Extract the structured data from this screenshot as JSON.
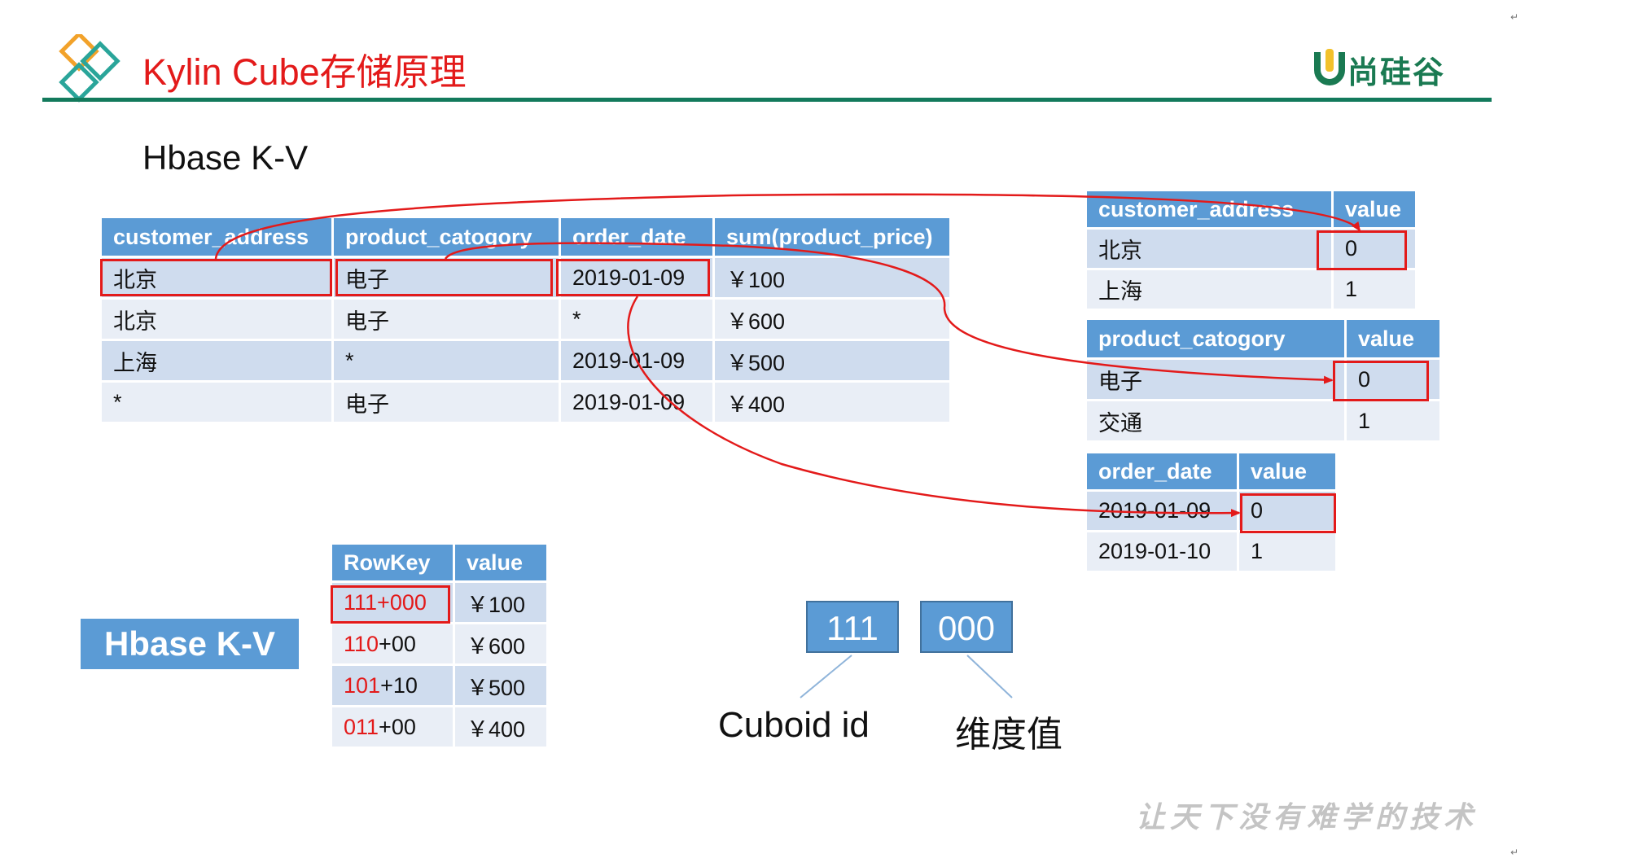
{
  "header": {
    "title": "Kylin Cube存储原理",
    "logo_text": "尚硅谷",
    "corner_mark": "↵"
  },
  "subtitle": "Hbase K-V",
  "source_table": {
    "columns": [
      "customer_address",
      "product_catogory",
      "order_date",
      "sum(product_price)"
    ],
    "rows": [
      [
        "北京",
        "电子",
        "2019-01-09",
        "￥100"
      ],
      [
        "北京",
        "电子",
        "*",
        "￥600"
      ],
      [
        "上海",
        "*",
        "2019-01-09",
        "￥500"
      ],
      [
        "*",
        "电子",
        "2019-01-09",
        "￥400"
      ]
    ]
  },
  "dict_customer_address": {
    "columns": [
      "customer_address",
      "value"
    ],
    "rows": [
      [
        "北京",
        "0"
      ],
      [
        "上海",
        "1"
      ]
    ]
  },
  "dict_product_catogory": {
    "columns": [
      "product_catogory",
      "value"
    ],
    "rows": [
      [
        "电子",
        "0"
      ],
      [
        "交通",
        "1"
      ]
    ]
  },
  "dict_order_date": {
    "columns": [
      "order_date",
      "value"
    ],
    "rows": [
      [
        "2019-01-09",
        "0"
      ],
      [
        "2019-01-10",
        "1"
      ]
    ]
  },
  "hbase_label": "Hbase K-V",
  "rowkey_table": {
    "columns": [
      "RowKey",
      "value"
    ],
    "rows": [
      {
        "cuboid": "111",
        "dims": "+000",
        "value": "￥100"
      },
      {
        "cuboid": "110",
        "dims": "+00",
        "value": "￥600"
      },
      {
        "cuboid": "101",
        "dims": "+10",
        "value": "￥500"
      },
      {
        "cuboid": "011",
        "dims": "+00",
        "value": "￥400"
      }
    ]
  },
  "key_diagram": {
    "cuboid_box": "111",
    "dims_box": "000",
    "cuboid_label": "Cuboid id",
    "dims_label": "维度值"
  },
  "slogan": "让天下没有难学的技术",
  "colors": {
    "accent_red": "#e31a1a",
    "header_blue": "#5b9bd5",
    "row_dark": "#cfdcee",
    "row_light": "#e9eef6",
    "brand_green": "#137a5c"
  }
}
